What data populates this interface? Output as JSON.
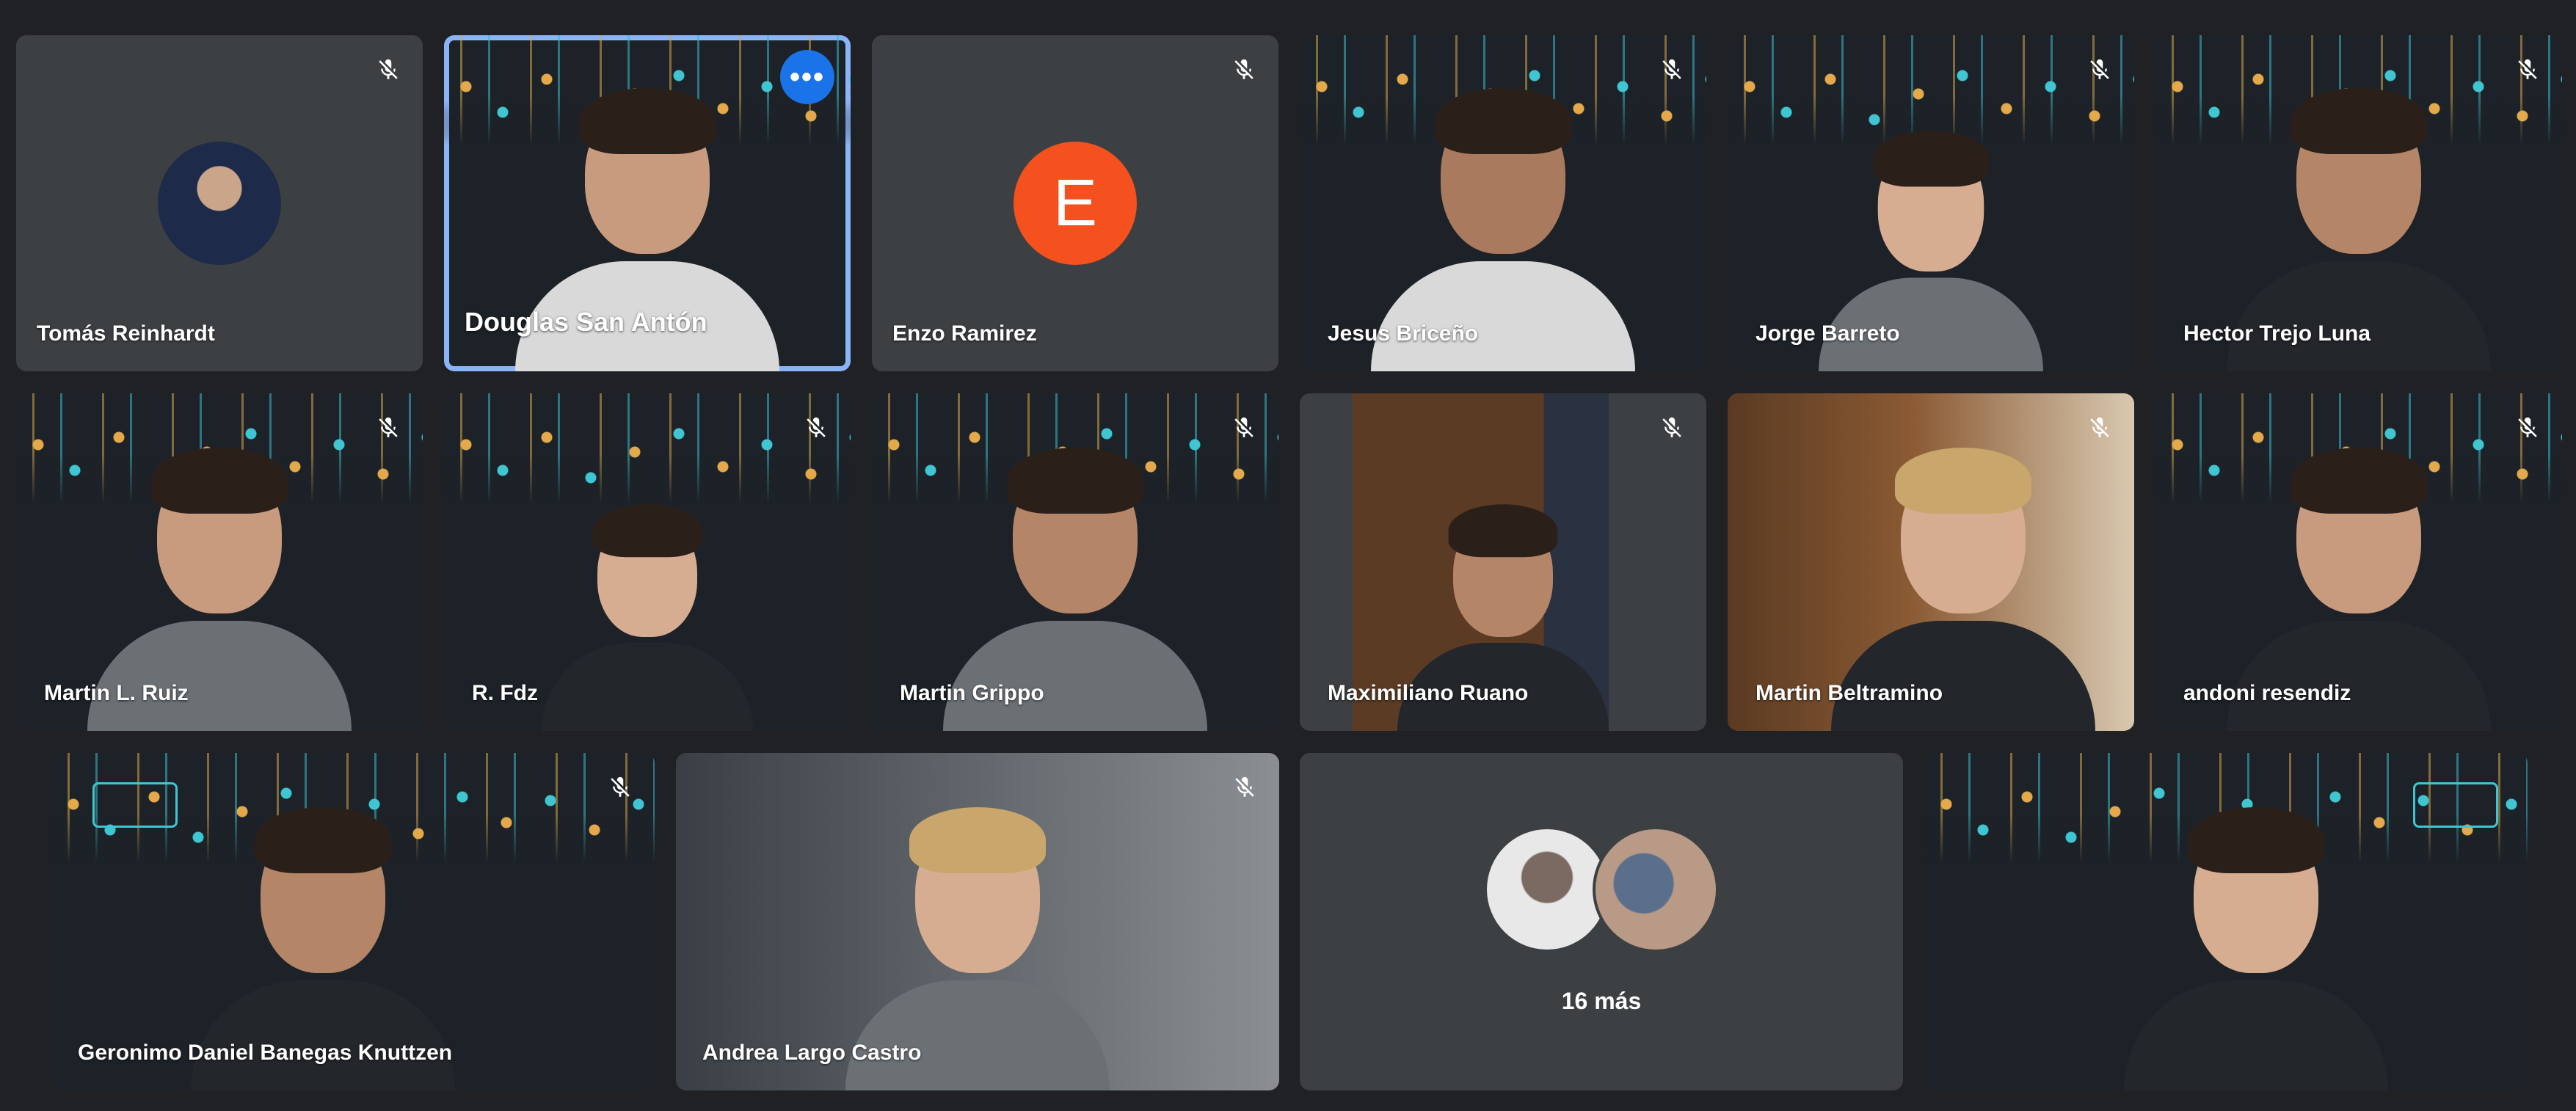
{
  "participants": [
    {
      "name": "Tomás Reinhardt",
      "muted": true,
      "view": "avatar-photo"
    },
    {
      "name": "Douglas San Antón",
      "muted": false,
      "view": "video",
      "active": true
    },
    {
      "name": "Enzo Ramirez",
      "muted": true,
      "view": "avatar-letter",
      "initial": "E"
    },
    {
      "name": "Jesus Briceño",
      "muted": true,
      "view": "video"
    },
    {
      "name": "Jorge Barreto",
      "muted": true,
      "view": "video"
    },
    {
      "name": "Hector Trejo Luna",
      "muted": true,
      "view": "video"
    },
    {
      "name": "Martin L. Ruiz",
      "muted": true,
      "view": "video"
    },
    {
      "name": "R. Fdz",
      "muted": true,
      "view": "video"
    },
    {
      "name": "Martin Grippo",
      "muted": true,
      "view": "video"
    },
    {
      "name": "Maximiliano Ruano",
      "muted": true,
      "view": "video"
    },
    {
      "name": "Martin Beltramino",
      "muted": true,
      "view": "video"
    },
    {
      "name": "andoni resendiz",
      "muted": true,
      "view": "video"
    },
    {
      "name": "Geronimo Daniel Banegas Knuttzen",
      "muted": true,
      "view": "video"
    },
    {
      "name": "Andrea Largo Castro",
      "muted": true,
      "view": "video"
    },
    {
      "name": "",
      "view": "group"
    },
    {
      "name": "",
      "muted": false,
      "view": "video"
    }
  ],
  "overflow": {
    "label": "16 más"
  },
  "more_button_glyph": "•••",
  "colors": {
    "background": "#202124",
    "tile": "#3c4043",
    "active_border": "#8ab4f8",
    "more_button": "#1a73e8",
    "avatar_letter": "#f4511e"
  },
  "icons": {
    "mic_off": "mic-off-icon",
    "more": "more-options-icon"
  }
}
